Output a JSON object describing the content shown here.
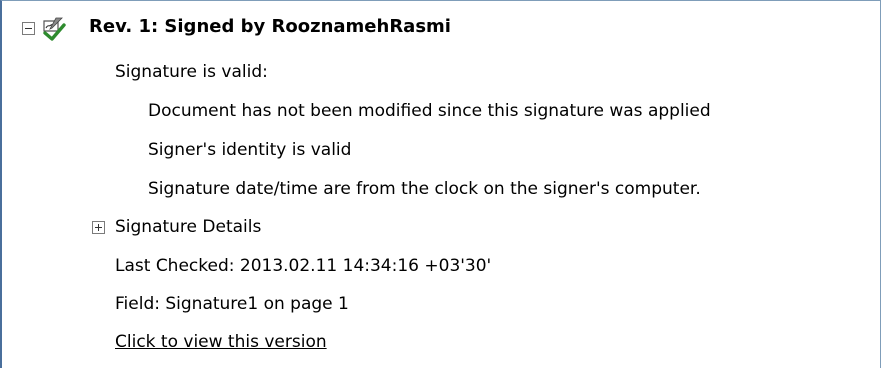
{
  "revision": {
    "title": "Rev. 1: Signed by RooznamehRasmi",
    "status": "Signature is valid:",
    "checks": [
      "Document has not been modified since this signature was applied",
      "Signer's identity is valid",
      "Signature date/time are from the clock on the signer's computer."
    ],
    "details_label": "Signature Details",
    "last_checked": "Last Checked: 2013.02.11 14:34:16 +03'30'",
    "field": "Field: Signature1 on page 1",
    "view_link": "Click to view this version"
  },
  "icons": {
    "collapse": "collapse-icon",
    "expand": "expand-icon",
    "signature": "signature-valid-icon"
  },
  "colors": {
    "panel_border": "#4a6f9c",
    "check_green": "#2e8b2e"
  }
}
